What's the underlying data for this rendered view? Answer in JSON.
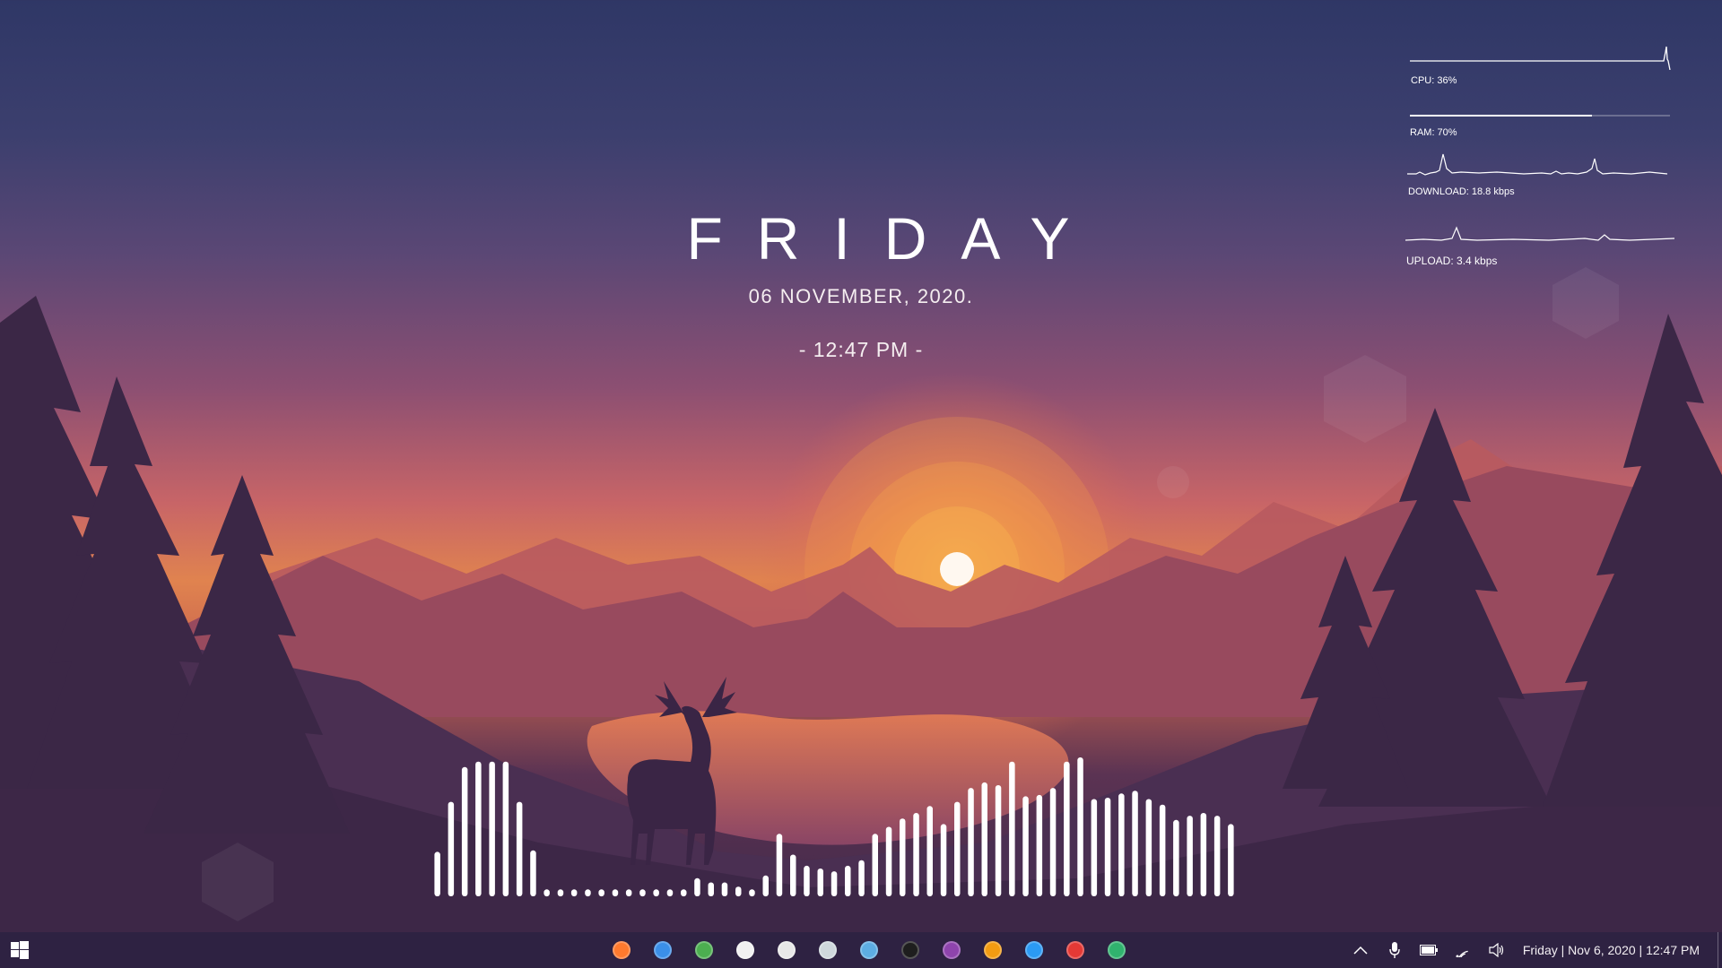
{
  "wallpaper": {
    "sky_top": "#2f3766",
    "sun_glow": "#f0a050",
    "sun": "#fff8f0",
    "silhouette": "#3e2848"
  },
  "clock": {
    "day": "FRIDAY",
    "date": "06  NOVEMBER,  2020.",
    "time": "- 12:47 PM -"
  },
  "stats": {
    "cpu": {
      "label": "CPU: 36%",
      "value": 0.36
    },
    "ram": {
      "label": "RAM: 70%",
      "value": 0.7
    },
    "download": {
      "label": "DOWNLOAD: 18.8 kbps"
    },
    "upload": {
      "label": "UPLOAD: 3.4 kbps"
    }
  },
  "visualizer": {
    "color": "#ffffff",
    "levels": [
      0.32,
      0.68,
      0.93,
      0.97,
      0.97,
      0.97,
      0.68,
      0.33,
      0.05,
      0.05,
      0.05,
      0.05,
      0.05,
      0.05,
      0.05,
      0.05,
      0.05,
      0.05,
      0.05,
      0.13,
      0.1,
      0.1,
      0.07,
      0.05,
      0.15,
      0.45,
      0.3,
      0.22,
      0.2,
      0.18,
      0.22,
      0.26,
      0.45,
      0.5,
      0.56,
      0.6,
      0.65,
      0.52,
      0.68,
      0.78,
      0.82,
      0.8,
      0.97,
      0.72,
      0.73,
      0.78,
      0.97,
      1.0,
      0.7,
      0.71,
      0.74,
      0.76,
      0.7,
      0.66,
      0.55,
      0.58,
      0.6,
      0.58,
      0.52
    ]
  },
  "taskbar": {
    "start_icon": "windows-logo-icon",
    "pinned": [
      {
        "name": "firefox-icon",
        "color": "#ff7a2e"
      },
      {
        "name": "thunderbird-icon",
        "color": "#3b8fe8"
      },
      {
        "name": "chrome-icon",
        "color": "#4caf50"
      },
      {
        "name": "settings-gear-icon",
        "color": "#f1f1f1"
      },
      {
        "name": "notepad-icon",
        "color": "#e8e8e8"
      },
      {
        "name": "calculator-icon",
        "color": "#cfd8dc"
      },
      {
        "name": "remote-desktop-icon",
        "color": "#5dade2"
      },
      {
        "name": "terminal-icon",
        "color": "#1e1e1e"
      },
      {
        "name": "podcast-app-icon",
        "color": "#8e44ad"
      },
      {
        "name": "vlc-icon",
        "color": "#f39c12"
      },
      {
        "name": "vscode-icon",
        "color": "#2b9af3"
      },
      {
        "name": "opera-icon",
        "color": "#e53935"
      },
      {
        "name": "edge-icon",
        "color": "#30b36e"
      }
    ],
    "tray_icons": [
      "chevron-up-icon",
      "microphone-icon",
      "battery-icon",
      "wifi-icon",
      "volume-icon"
    ],
    "tray_clock": "Friday | Nov 6, 2020 | 12:47 PM"
  }
}
